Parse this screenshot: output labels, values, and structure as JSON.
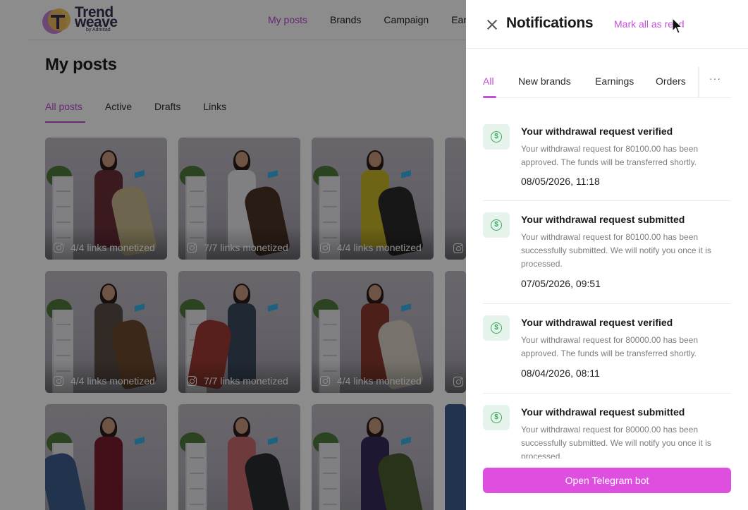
{
  "app": {
    "logo": {
      "line1": "Trend",
      "line2": "weave",
      "sub": "by Admitad"
    },
    "nav": {
      "items": [
        "My posts",
        "Brands",
        "Campaign",
        "Earn"
      ],
      "active_index": 0
    },
    "page_title": "My posts",
    "post_tabs": [
      "All posts",
      "Active",
      "Drafts",
      "Links"
    ],
    "posts": [
      {
        "caption": "4/4 links monetized"
      },
      {
        "caption": "7/7 links monetized"
      },
      {
        "caption": "4/4 links monetized"
      },
      {
        "caption": "4/4 links monetized"
      },
      {
        "caption": "7/7 links monetized"
      },
      {
        "caption": "4/4 links monetized"
      }
    ]
  },
  "drawer": {
    "title": "Notifications",
    "mark_all_label": "Mark all as read",
    "tabs": [
      "All",
      "New brands",
      "Earnings",
      "Orders"
    ],
    "more_label": "···",
    "notifications": [
      {
        "title": "Your withdrawal request verified",
        "body": "Your withdrawal request for 80100.00 has been approved. The funds will be transferred shortly.",
        "time": "08/05/2026, 11:18"
      },
      {
        "title": "Your withdrawal request submitted",
        "body": "Your withdrawal request for 80100.00 has been successfully submitted. We will notify you once it is processed.",
        "time": "07/05/2026, 09:51"
      },
      {
        "title": "Your withdrawal request verified",
        "body": "Your withdrawal request for 80000.00 has been approved. The funds will be transferred shortly.",
        "time": "08/04/2026, 08:11"
      },
      {
        "title": "Your withdrawal request submitted",
        "body": "Your withdrawal request for 80000.00 has been successfully submitted. We will notify you once it is processed.",
        "time": ""
      }
    ],
    "telegram_button": "Open Telegram bot"
  },
  "colors": {
    "accent": "#c64fd9",
    "button": "#de4fe0",
    "success_icon": "#35a964",
    "success_bg": "#e6f3ea"
  },
  "icons": {
    "close": "close-icon",
    "notification": "dollar-circle-icon",
    "post": "instagram-icon"
  }
}
